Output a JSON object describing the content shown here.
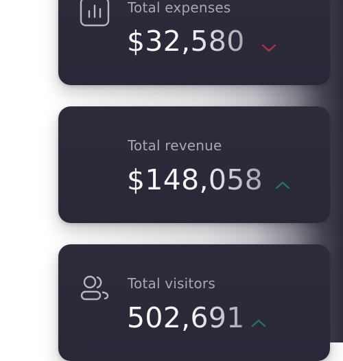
{
  "colors": {
    "card_background": "#2c2a39",
    "label": "#a9a6b6",
    "value": "#ffffff",
    "trend_up": "#1f7a5a",
    "trend_down": "#a8364a"
  },
  "cards": [
    {
      "label": "Total expenses",
      "value": "$32,580",
      "icon": "bar-chart-icon",
      "trend": "down"
    },
    {
      "label": "Total revenue",
      "value": "$148,058",
      "icon": "",
      "trend": "up"
    },
    {
      "label": "Total visitors",
      "value": "502,691",
      "icon": "users-icon",
      "trend": "up"
    }
  ]
}
